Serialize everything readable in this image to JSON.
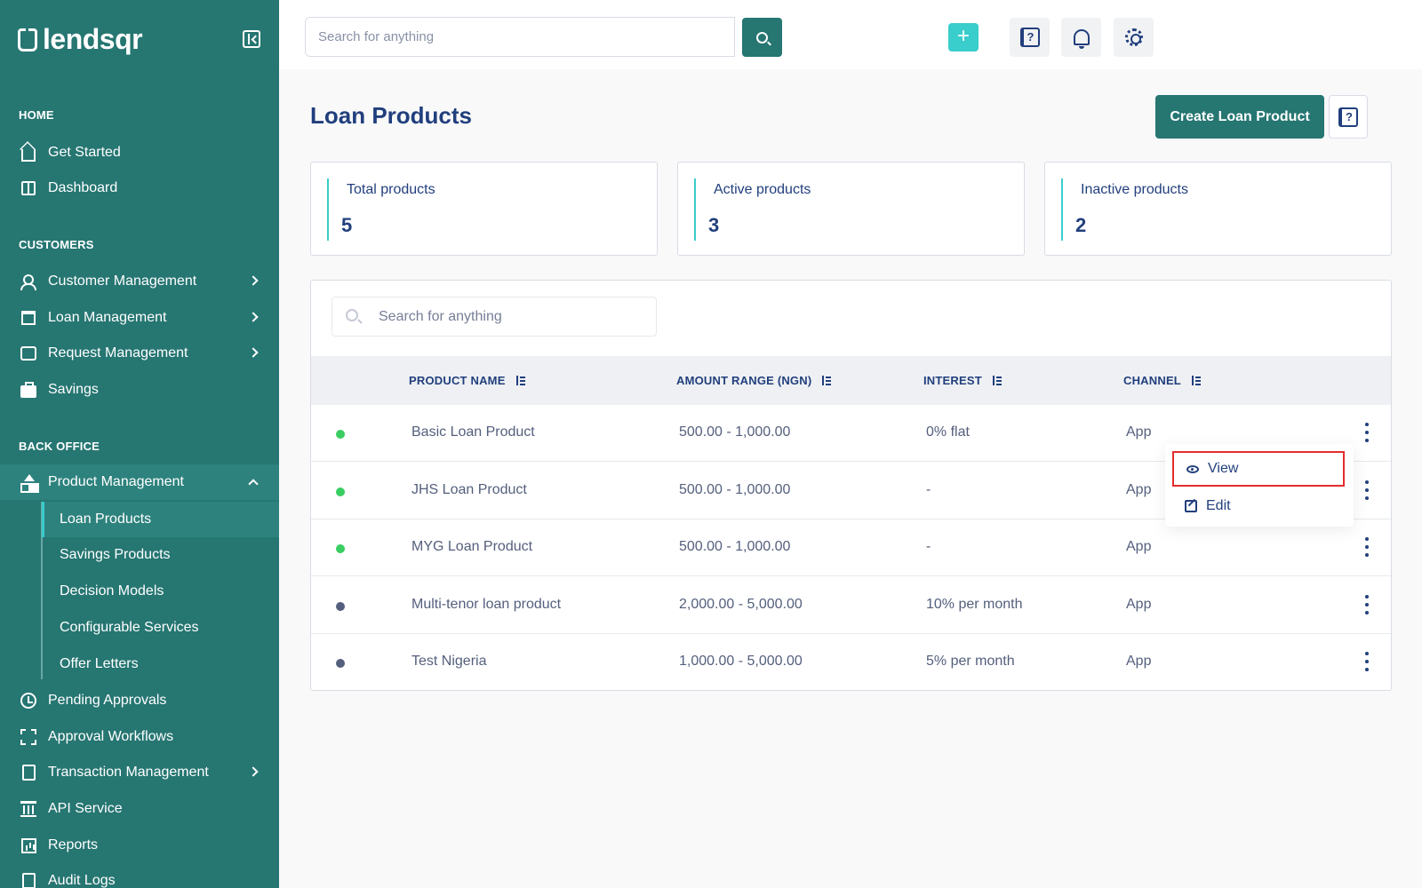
{
  "brand": {
    "name": "lendsqr"
  },
  "colors": {
    "sidebar": "#267672",
    "accent": "#39cdcc",
    "active_status": "#39cd62",
    "inactive_status": "#545f7d",
    "highlight": "#e32d2d"
  },
  "sidebar": {
    "sections": {
      "home": "HOME",
      "customers": "CUSTOMERS",
      "back_office": "BACK OFFICE"
    },
    "items": {
      "get_started": "Get Started",
      "dashboard": "Dashboard",
      "customer_management": "Customer Management",
      "loan_management": "Loan Management",
      "request_management": "Request Management",
      "savings": "Savings",
      "product_management": "Product Management",
      "pending_approvals": "Pending Approvals",
      "approval_workflows": "Approval Workflows",
      "transaction_management": "Transaction Management",
      "api_service": "API Service",
      "reports": "Reports",
      "audit_logs": "Audit Logs"
    },
    "sub_items": {
      "loan_products": "Loan Products",
      "savings_products": "Savings Products",
      "decision_models": "Decision Models",
      "configurable_services": "Configurable Services",
      "offer_letters": "Offer Letters"
    }
  },
  "topbar": {
    "search_placeholder": "Search for anything",
    "plus_label": "+"
  },
  "page": {
    "title": "Loan Products",
    "create_button": "Create Loan Product",
    "help_glyph": "?"
  },
  "stats": {
    "total": {
      "label": "Total products",
      "value": "5"
    },
    "active": {
      "label": "Active products",
      "value": "3"
    },
    "inactive": {
      "label": "Inactive products",
      "value": "2"
    }
  },
  "table": {
    "search_placeholder": "Search for anything",
    "columns": {
      "name": "PRODUCT NAME",
      "amount": "AMOUNT RANGE (NGN)",
      "interest": "INTEREST",
      "channel": "CHANNEL"
    },
    "rows": [
      {
        "status": "active",
        "name": "Basic Loan Product",
        "amount": "500.00 - 1,000.00",
        "interest": "0% flat",
        "channel": "App"
      },
      {
        "status": "active",
        "name": "JHS Loan Product",
        "amount": "500.00 - 1,000.00",
        "interest": "-",
        "channel": "App"
      },
      {
        "status": "active",
        "name": "MYG Loan Product",
        "amount": "500.00 - 1,000.00",
        "interest": "-",
        "channel": "App"
      },
      {
        "status": "inactive",
        "name": "Multi-tenor loan product",
        "amount": "2,000.00 - 5,000.00",
        "interest": "10% per month",
        "channel": "App"
      },
      {
        "status": "inactive",
        "name": "Test Nigeria",
        "amount": "1,000.00 - 5,000.00",
        "interest": "5% per month",
        "channel": "App"
      }
    ]
  },
  "row_menu": {
    "view": "View",
    "edit": "Edit"
  }
}
